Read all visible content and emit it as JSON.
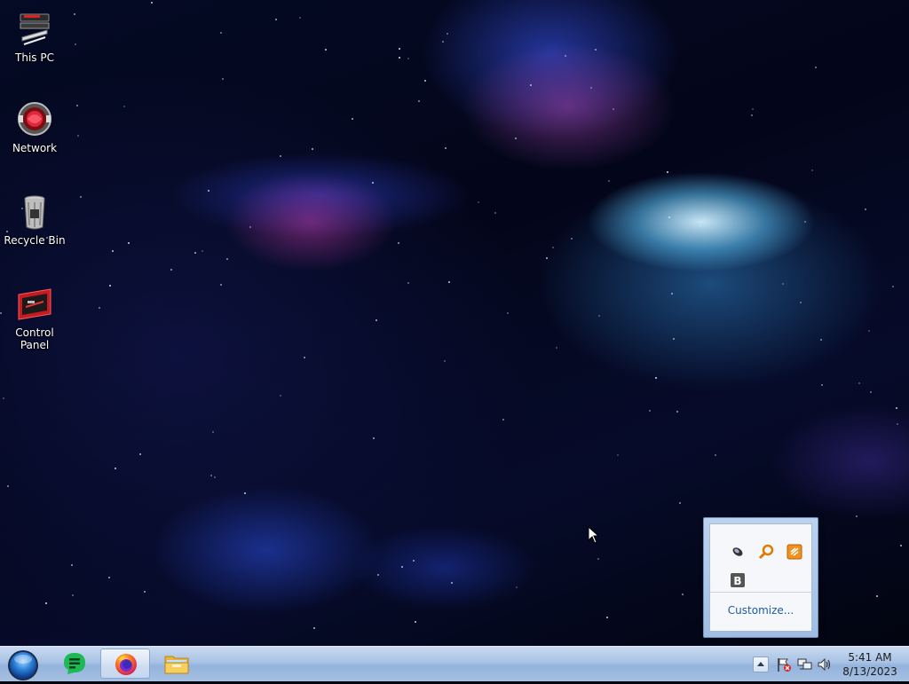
{
  "desktop": {
    "icons": [
      {
        "label": "This PC",
        "icon": "this-pc-icon"
      },
      {
        "label": "Network",
        "icon": "network-icon"
      },
      {
        "label": "Recycle Bin",
        "icon": "recycle-bin-icon"
      },
      {
        "label": "Control Panel",
        "icon": "control-panel-icon"
      }
    ]
  },
  "tray_popup": {
    "icons": [
      "usb-eject-icon",
      "search-tool-icon",
      "sound-app-icon",
      "b-app-icon"
    ],
    "b_icon_text": "B",
    "customize_label": "Customize..."
  },
  "taskbar": {
    "pinned": [
      "start-orb-icon",
      "notes-app-icon",
      "firefox-icon",
      "file-explorer-icon"
    ],
    "active_app": "Firefox",
    "tray_icons": [
      "show-hidden-icons-button",
      "action-center-flag-icon",
      "network-tray-icon",
      "volume-icon"
    ],
    "clock": {
      "time": "5:41 AM",
      "date": "8/13/2023"
    }
  },
  "colors": {
    "taskbar": "#a8c2e4",
    "link": "#1e5aa8",
    "popup_bg": "#f5f7fa"
  }
}
